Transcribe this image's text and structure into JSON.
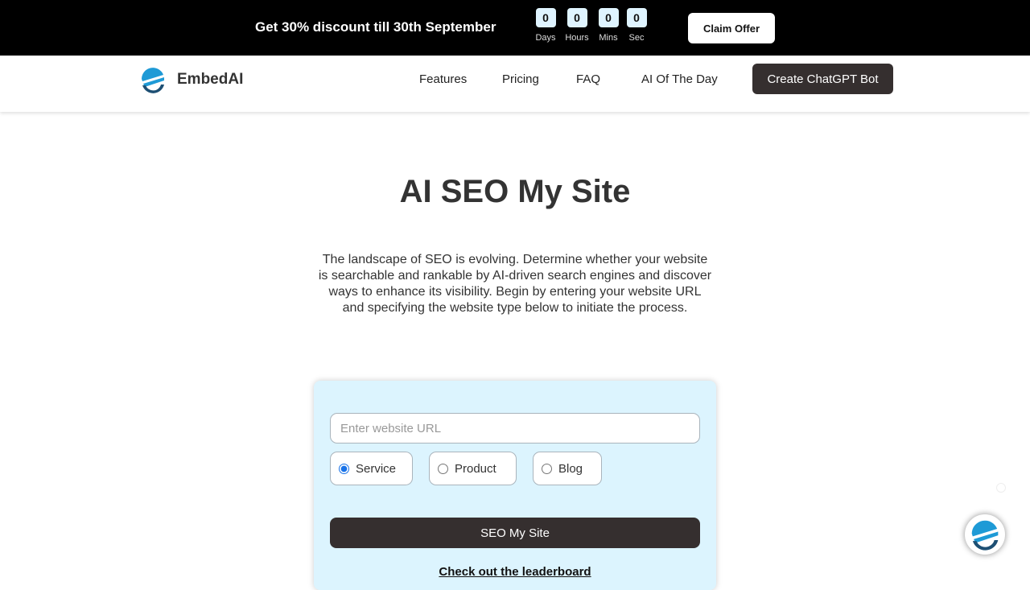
{
  "promo": {
    "text": "Get 30% discount till 30th September",
    "countdown": [
      {
        "value": "0",
        "label": "Days"
      },
      {
        "value": "0",
        "label": "Hours"
      },
      {
        "value": "0",
        "label": "Mins"
      },
      {
        "value": "0",
        "label": "Sec"
      }
    ],
    "claim_label": "Claim Offer"
  },
  "nav": {
    "brand": "EmbedAI",
    "links": [
      "Features",
      "Pricing",
      "FAQ",
      "AI Of The Day"
    ],
    "cta_label": "Create ChatGPT Bot"
  },
  "hero": {
    "title": "AI SEO My Site",
    "description": "The landscape of SEO is evolving. Determine whether your website is searchable and rankable by AI-driven search engines and discover ways to enhance its visibility. Begin by entering your website URL and specifying the website type below to initiate the process."
  },
  "form": {
    "url_placeholder": "Enter website URL",
    "url_value": "",
    "types": [
      {
        "label": "Service",
        "checked": true
      },
      {
        "label": "Product",
        "checked": false
      },
      {
        "label": "Blog",
        "checked": false
      }
    ],
    "submit_label": "SEO My Site",
    "leaderboard_link": "Check out the leaderboard"
  },
  "colors": {
    "accent_dark": "#352f2f",
    "card_bg": "#dcf4fe",
    "logo_blue": "#1e9ad6",
    "logo_navy": "#1d4f73"
  }
}
